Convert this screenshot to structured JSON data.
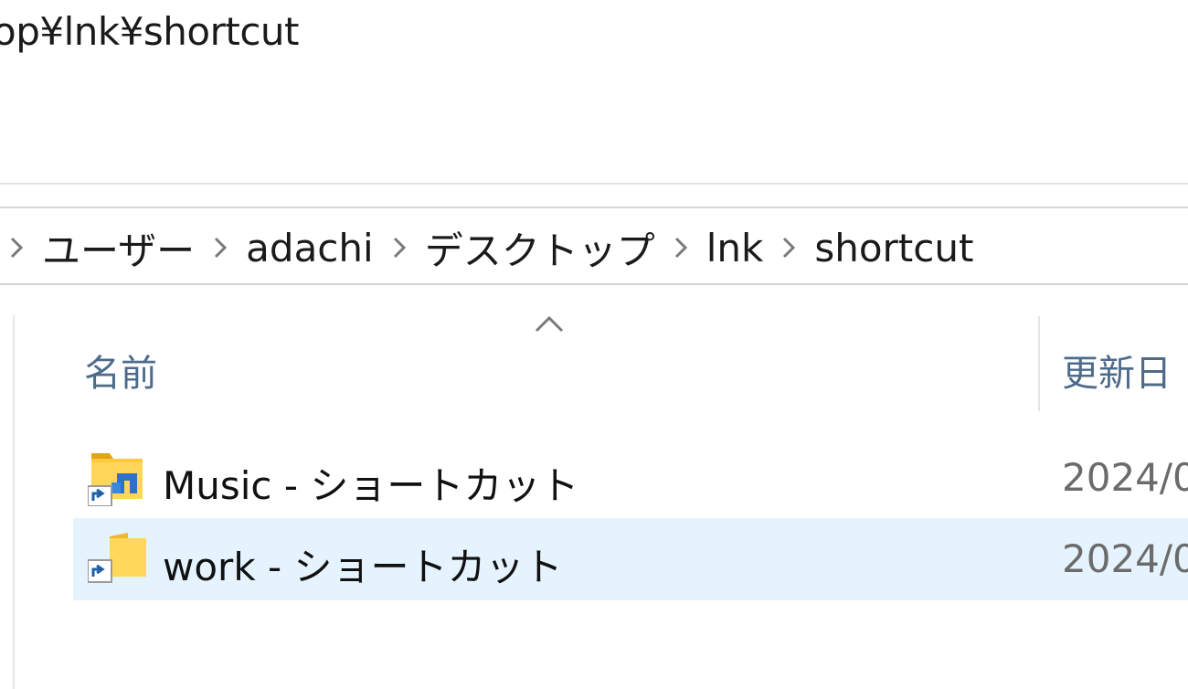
{
  "window": {
    "title_path": "op¥lnk¥shortcut"
  },
  "address_bar": {
    "breadcrumbs": [
      {
        "label": "ユーザー"
      },
      {
        "label": "adachi"
      },
      {
        "label": "デスクトップ"
      },
      {
        "label": "lnk"
      },
      {
        "label": "shortcut"
      }
    ]
  },
  "file_list": {
    "columns": {
      "name": "名前",
      "date_modified": "更新日"
    },
    "sort": "ascending",
    "rows": [
      {
        "name": "Music - ショートカット",
        "date": "2024/0",
        "icon": "music-folder-shortcut-icon",
        "selected": false
      },
      {
        "name": "work - ショートカット",
        "date": "2024/0",
        "icon": "folder-shortcut-icon",
        "selected": true
      }
    ]
  },
  "colors": {
    "selection": "#e5f3ff",
    "header_text": "#4d6b8a",
    "folder_yellow": "#ffca28",
    "shortcut_arrow": "#1f5fa8"
  }
}
